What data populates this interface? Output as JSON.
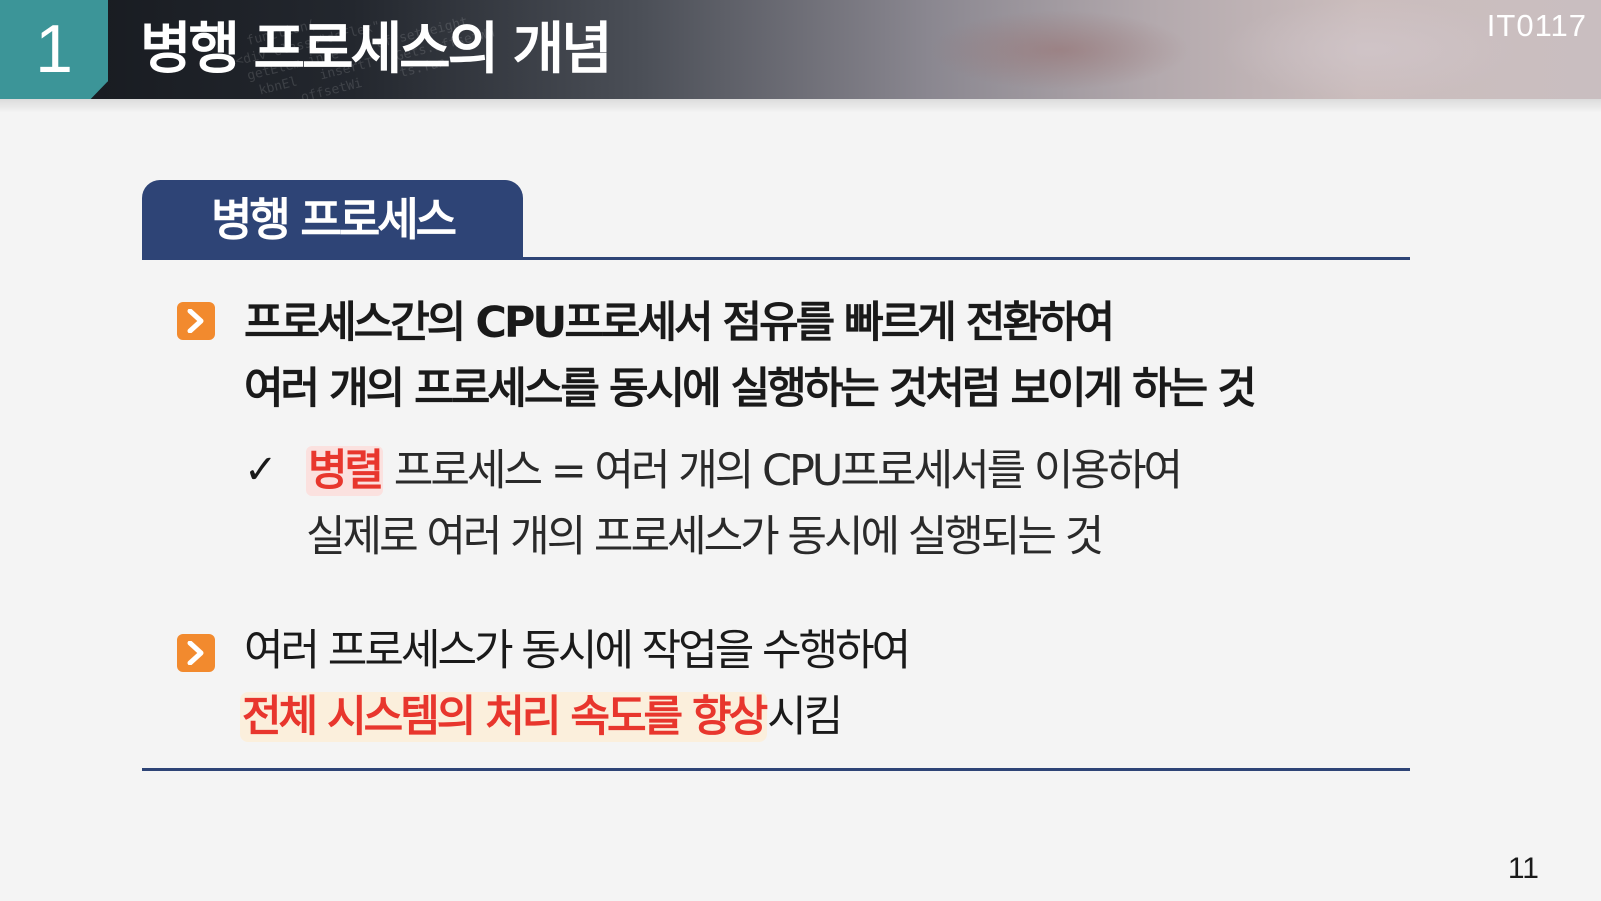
{
  "header": {
    "chapter_number": "1",
    "title": "병행 프로세스의 개념",
    "course_code": "IT0117"
  },
  "section": {
    "tab_label": "병행 프로세스"
  },
  "bullets": [
    {
      "line1": "프로세스간의 CPU프로세서 점유를 빠르게 전환하여",
      "line2": "여러 개의 프로세스를 동시에 실행하는 것처럼 보이게 하는 것",
      "sub": {
        "highlight": "병렬",
        "line1_rest": " 프로세스 = 여러 개의 CPU프로세서를 이용하여",
        "line2": "실제로 여러 개의 프로세스가 동시에 실행되는 것"
      }
    },
    {
      "line1": "여러 프로세스가 동시에 작업을 수행하여",
      "line2_highlight": "전체 시스템의 처리 속도를 향상",
      "line2_rest": "시킴"
    }
  ],
  "icons": {
    "bullet": "chevron-right-icon",
    "check": "checkmark-icon"
  },
  "colors": {
    "header_badge": "#3c9598",
    "section_tab": "#2e4476",
    "bullet_icon": "#f28a2e",
    "highlight_text": "#e8362d"
  },
  "footer": {
    "page_number": "11"
  }
}
